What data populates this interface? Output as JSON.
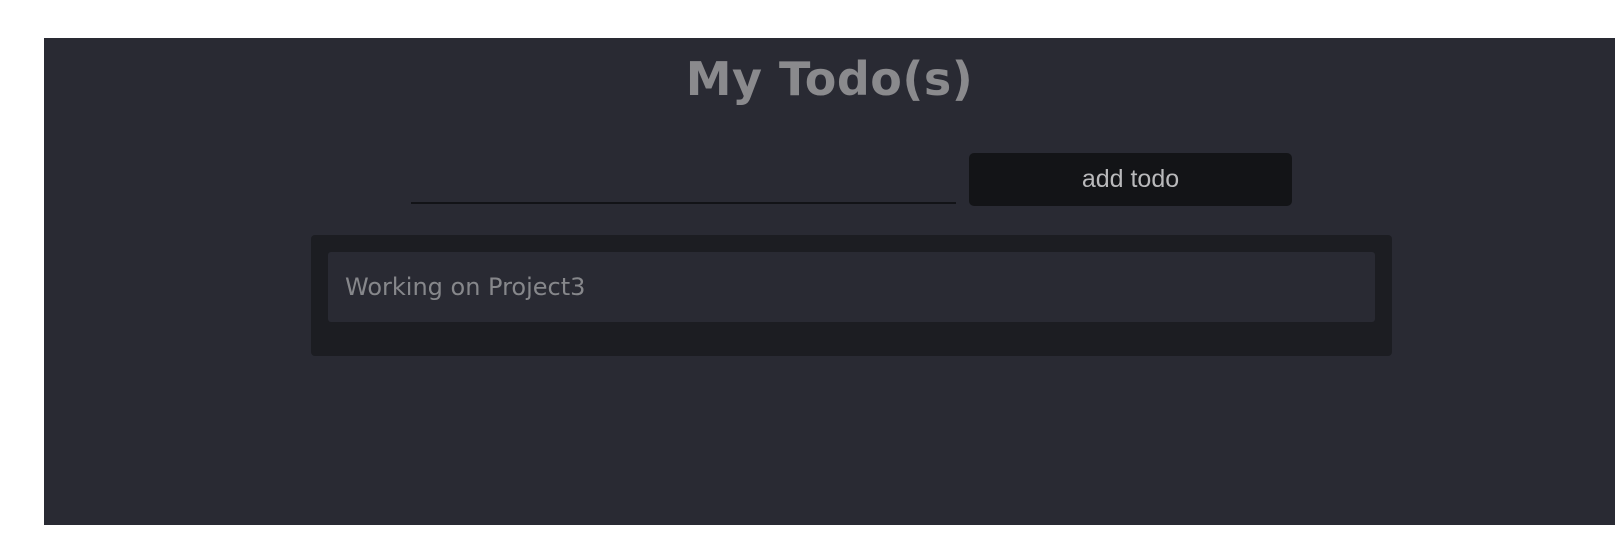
{
  "app": {
    "title": "My Todo(s)"
  },
  "form": {
    "input_value": "",
    "input_placeholder": "",
    "add_button_label": "add todo"
  },
  "todos": [
    {
      "text": "Working on Project3"
    }
  ],
  "colors": {
    "page_background": "#ffffff",
    "app_background": "#292a33",
    "list_background": "#1c1d22",
    "item_background": "#292a33",
    "button_background": "#131417",
    "title_text": "#8a8a8d",
    "item_text": "#86878b"
  }
}
